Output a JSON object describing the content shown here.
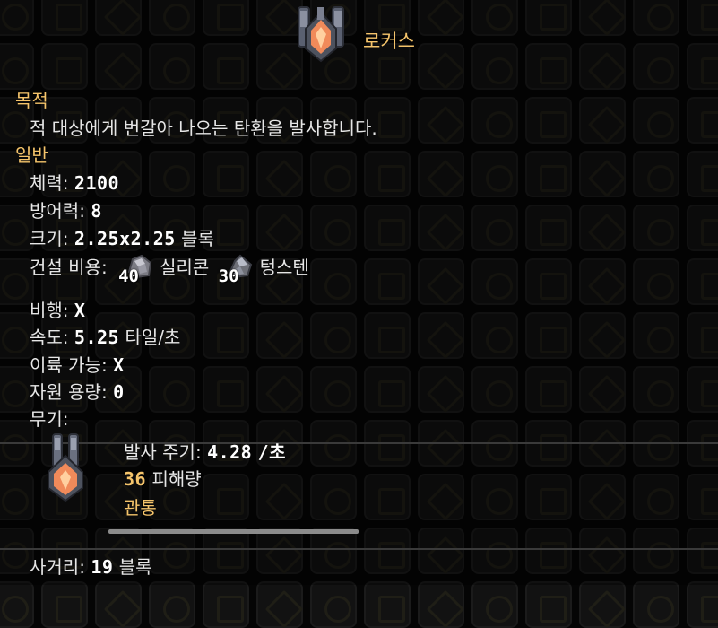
{
  "unit": {
    "name": "로커스",
    "icon": "locus-turret-icon"
  },
  "purpose": {
    "heading": "목적",
    "description": "적 대상에게 번갈아 나오는 탄환을 발사합니다."
  },
  "general": {
    "heading": "일반",
    "health_label": "체력:",
    "health_value": "2100",
    "armor_label": "방어력:",
    "armor_value": "8",
    "size_label": "크기:",
    "size_value": "2.25x2.25",
    "size_unit": "블록",
    "build_cost_label": "건설 비용:",
    "build_cost": [
      {
        "amount": "40",
        "item": "실리콘",
        "icon": "silicon-icon"
      },
      {
        "amount": "30",
        "item": "텅스텐",
        "icon": "tungsten-icon"
      }
    ],
    "flying_label": "비행:",
    "flying_value": "X",
    "speed_label": "속도:",
    "speed_value": "5.25",
    "speed_unit": "타일/초",
    "can_boost_label": "이륙 가능:",
    "can_boost_value": "X",
    "item_capacity_label": "자원 용량:",
    "item_capacity_value": "0",
    "weapons_label": "무기:"
  },
  "weapon": {
    "icon": "locus-weapon-icon",
    "fire_rate_label": "발사 주기:",
    "fire_rate_value": "4.28",
    "fire_rate_unit": "/초",
    "damage_value": "36",
    "damage_label": "피해량",
    "pierce_label": "관통"
  },
  "range": {
    "label": "사거리:",
    "value": "19",
    "unit": "블록"
  },
  "colors": {
    "accent_gold": "#f5c46b",
    "text": "#e6e6e6",
    "background": "#050505"
  }
}
